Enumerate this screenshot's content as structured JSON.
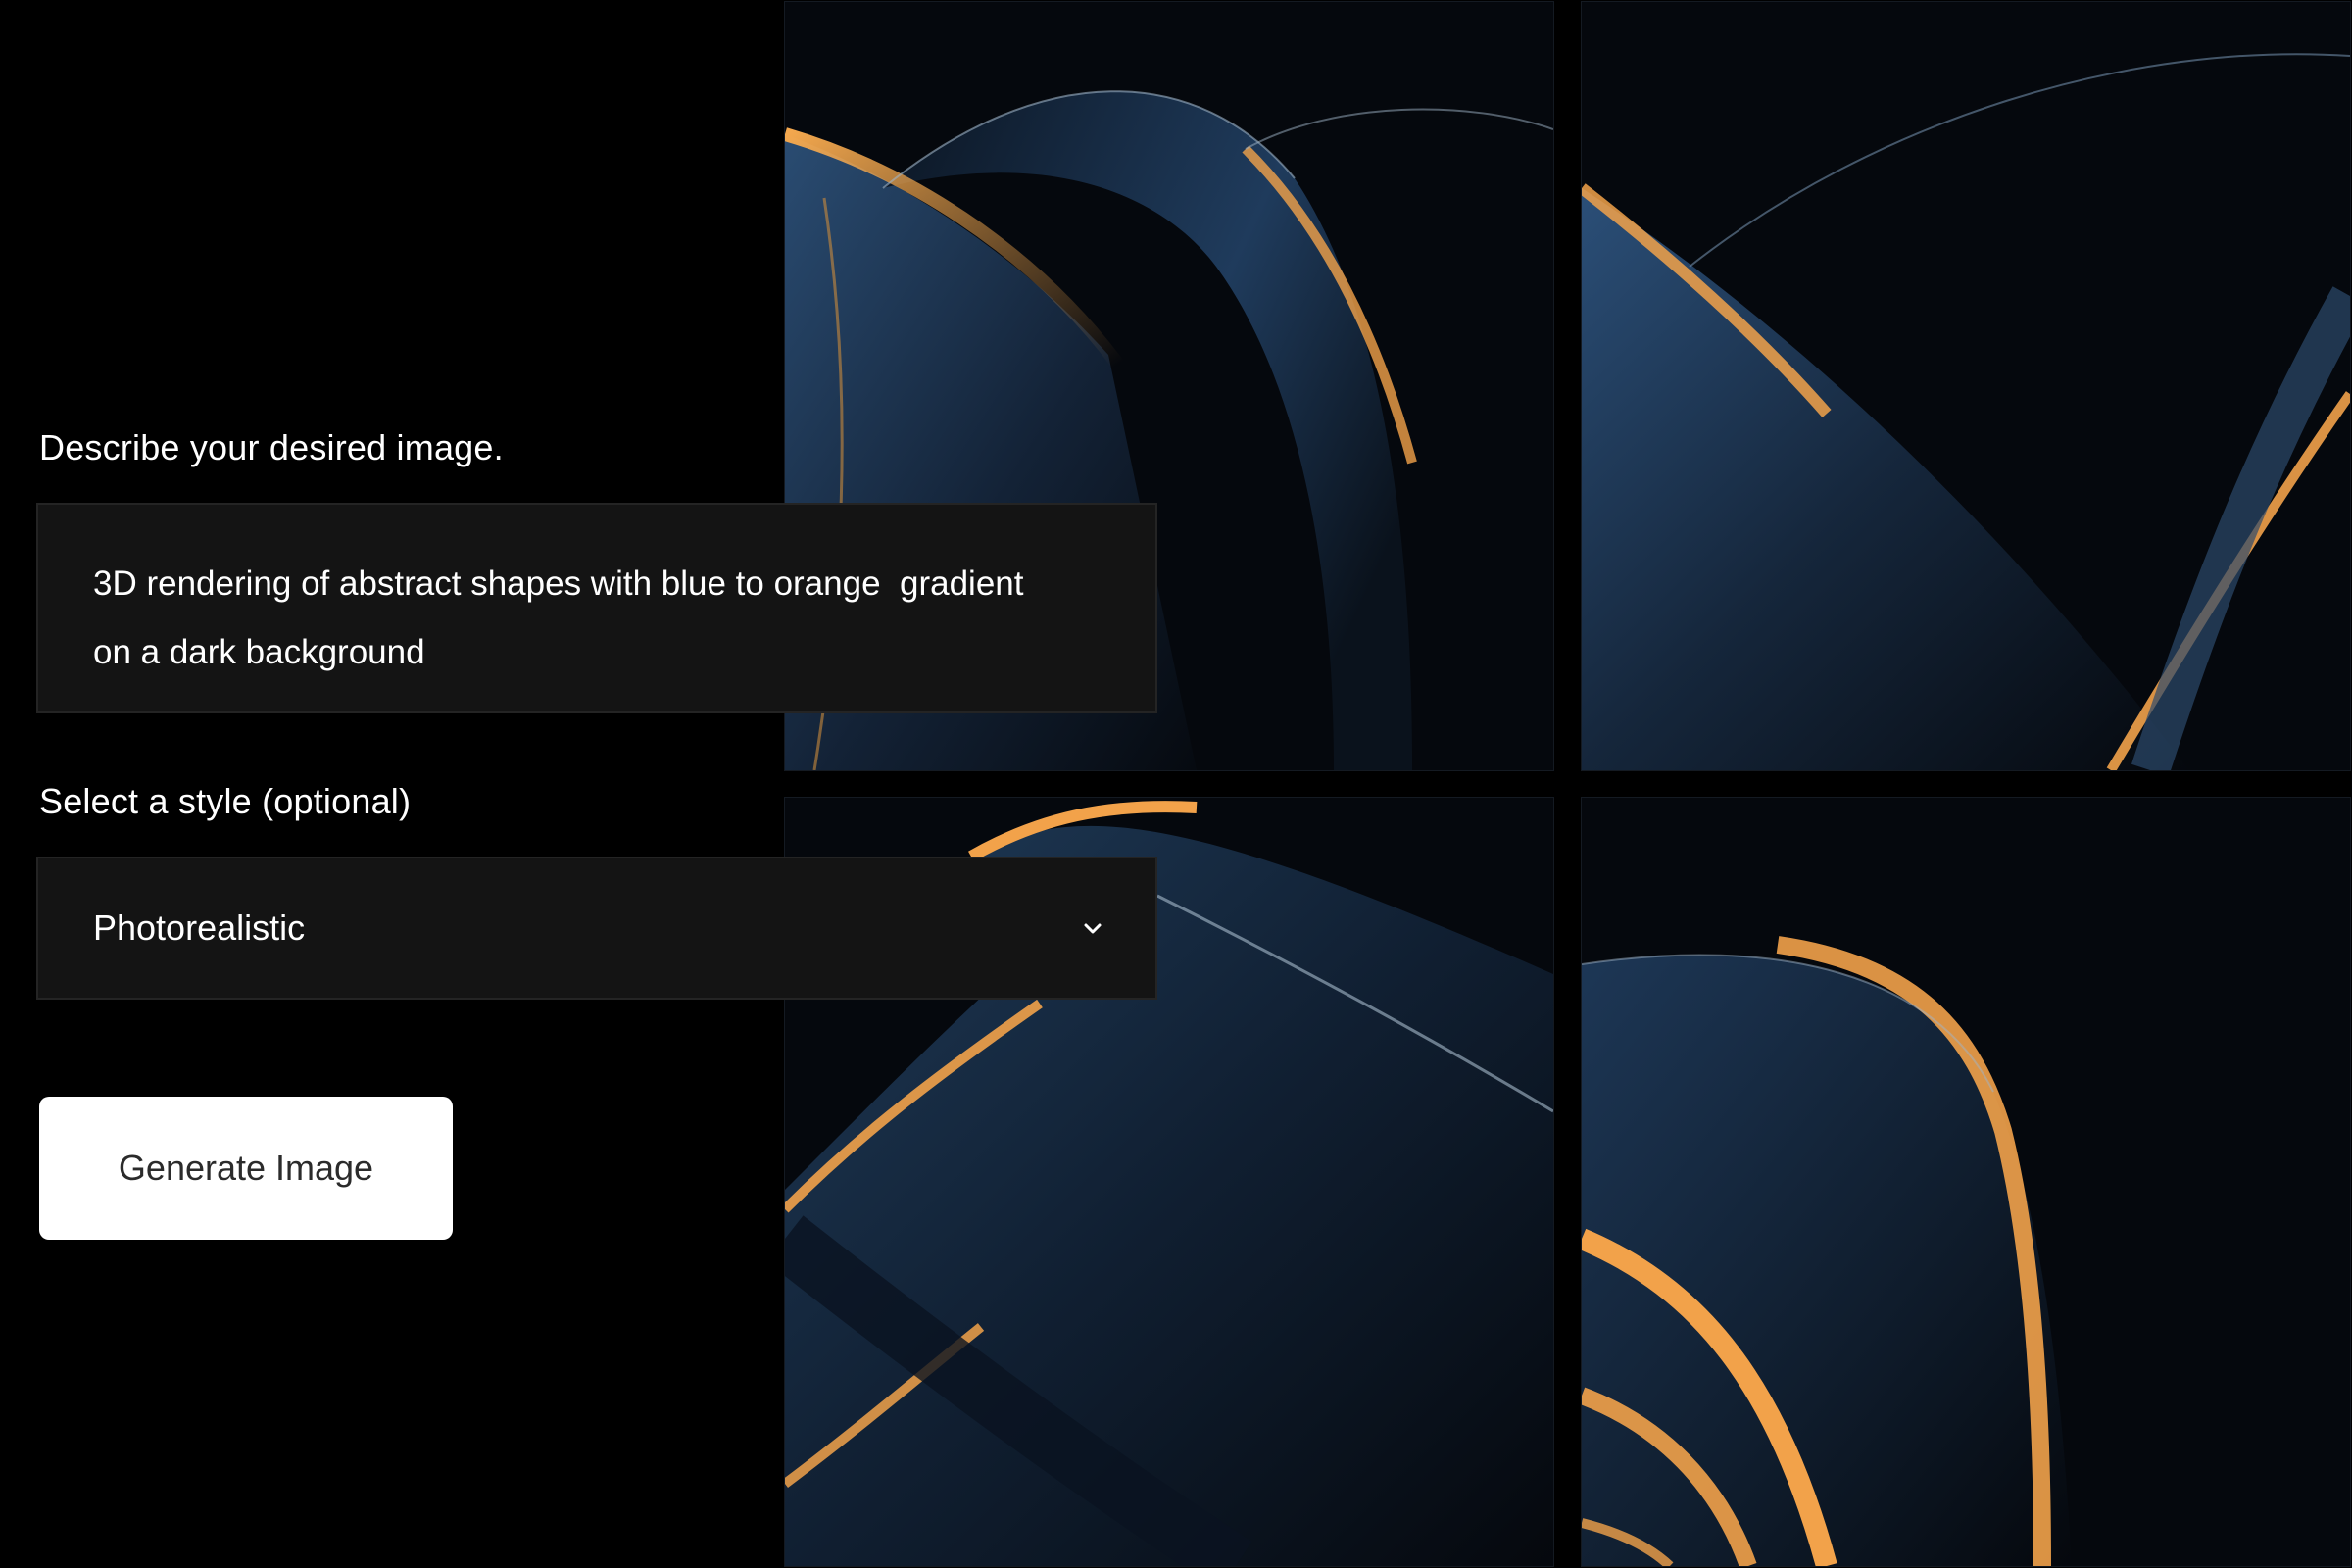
{
  "form": {
    "prompt_label": "Describe your desired image.",
    "prompt_value": "3D rendering of abstract shapes with blue to orange  gradient\non a dark background",
    "style_label": "Select a style (optional)",
    "style_selected": "Photorealistic",
    "style_chevron_icon": "chevron-down-icon",
    "generate_button_label": "Generate Image"
  },
  "gallery": {
    "tiles": [
      {
        "subject": "abstract-3d-shapes"
      },
      {
        "subject": "abstract-3d-shapes"
      },
      {
        "subject": "abstract-3d-shapes"
      },
      {
        "subject": "abstract-3d-shapes"
      }
    ]
  },
  "colors": {
    "background": "#000000",
    "panel_fill": "#141414",
    "panel_border": "#242424",
    "text": "#ffffff",
    "button_fill": "#ffffff",
    "button_text": "#2b2b2b",
    "shape_blue": "#1e3a5a",
    "shape_orange": "#f2a24a"
  }
}
